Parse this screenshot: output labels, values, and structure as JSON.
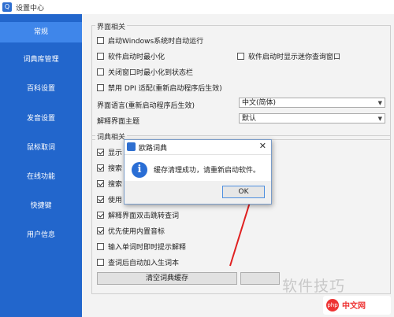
{
  "window": {
    "title": "设置中心"
  },
  "sidebar": {
    "items": [
      {
        "label": "常规",
        "active": true
      },
      {
        "label": "词典库管理"
      },
      {
        "label": "百科设置"
      },
      {
        "label": "发音设置"
      },
      {
        "label": "鼠标取词"
      },
      {
        "label": "在线功能"
      },
      {
        "label": "快捷键"
      },
      {
        "label": "用户信息"
      }
    ],
    "bg_color": "#2266cc",
    "active_color": "#3f86ea"
  },
  "interface": {
    "group_title": "界面相关",
    "checkboxes": [
      {
        "label": "启动Windows系统时自动运行",
        "checked": false
      },
      {
        "label": "软件启动时最小化",
        "checked": false
      },
      {
        "label": "软件启动时显示迷你查询窗口",
        "checked": false
      },
      {
        "label": "关闭窗口时最小化到状态栏",
        "checked": false
      },
      {
        "label": "禁用 DPI 适配(重新启动程序后生效)",
        "checked": false
      }
    ],
    "language_label": "界面语言(重新启动程序后生效)",
    "language_value": "中文(简体)",
    "theme_label": "解释界面主题",
    "theme_value": "默认"
  },
  "dictionary": {
    "group_title": "词典相关",
    "partial_labels": [
      "显示",
      "搜索",
      "搜索",
      "使用"
    ],
    "checkboxes": [
      {
        "label": "解释界面双击跳转查词",
        "checked": true
      },
      {
        "label": "优先使用内置音标",
        "checked": true
      },
      {
        "label": "输入单词时即时提示解释",
        "checked": false
      },
      {
        "label": "查词后自动加入生词本",
        "checked": false
      }
    ],
    "clear_cache_button": "清空词典缓存"
  },
  "dialog": {
    "title": "欧路词典",
    "message": "缓存清理成功，请重新启动软件。",
    "ok_label": "OK"
  },
  "watermark": {
    "text": "软件技巧",
    "logo_text": "中文网",
    "php": "php"
  }
}
